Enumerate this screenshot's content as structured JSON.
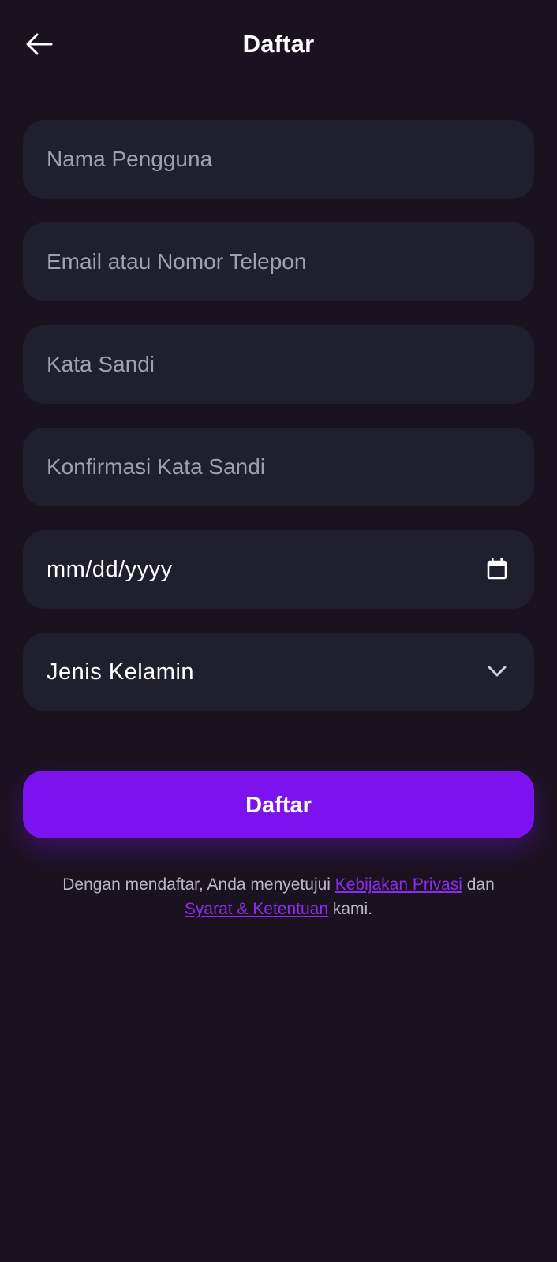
{
  "header": {
    "title": "Daftar",
    "back_icon": "arrow-left-icon"
  },
  "form": {
    "username": {
      "placeholder": "Nama Pengguna",
      "value": ""
    },
    "email_phone": {
      "placeholder": "Email atau Nomor Telepon",
      "value": ""
    },
    "password": {
      "placeholder": "Kata Sandi",
      "value": ""
    },
    "confirm_password": {
      "placeholder": "Konfirmasi Kata Sandi",
      "value": ""
    },
    "birthdate": {
      "display": "mm/dd/yyyy",
      "icon": "calendar-icon"
    },
    "gender": {
      "display": "Jenis Kelamin",
      "icon": "chevron-down-icon"
    }
  },
  "submit": {
    "label": "Daftar"
  },
  "terms": {
    "prefix": "Dengan mendaftar, Anda menyetujui ",
    "privacy_link": "Kebijakan Privasi",
    "middle": " dan",
    "tos_link": "Syarat & Ketentuan",
    "suffix": " kami."
  },
  "colors": {
    "background": "#1b1220",
    "field_background": "#1f1f2e",
    "accent": "#7c12ee",
    "link": "#8b2cf0"
  }
}
